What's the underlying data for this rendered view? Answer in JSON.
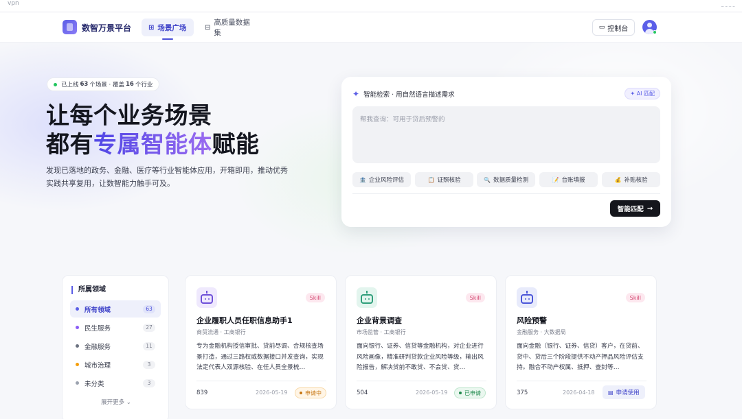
{
  "browser": {
    "url_text": "vpn"
  },
  "nav": {
    "brand": "数智万景平台",
    "tabs": [
      {
        "label": "场景广场",
        "icon": "grid-icon",
        "active": true
      },
      {
        "label": "高质量数据集",
        "icon": "database-icon",
        "active": false
      }
    ],
    "console_label": "控制台"
  },
  "hero": {
    "stat_prefix": "已上线",
    "stat_scenes": "63",
    "stat_mid": "个场景 · 覆盖",
    "stat_industries": "16",
    "stat_suffix": "个行业",
    "title_line1": "让每个业务场景",
    "title_line2_pre": "都有",
    "title_line2_accent": "专属智能体",
    "title_line2_post": "赋能",
    "description": "发现已落地的政务、金融、医疗等行业智能体应用，开箱即用，推动优秀实践共享复用，让数智能力触手可及。"
  },
  "search": {
    "heading": "智能检索 · 用自然语言描述需求",
    "ai_badge": "✦ AI 匹配",
    "placeholder": "帮我查询：可用于贷后预警的",
    "chips": [
      {
        "label": "企业风险评估",
        "icon": "🏦"
      },
      {
        "label": "证照核验",
        "icon": "📋"
      },
      {
        "label": "数据质量检测",
        "icon": "🔍"
      },
      {
        "label": "台账填报",
        "icon": "📝"
      },
      {
        "label": "补贴核验",
        "icon": "💰"
      }
    ],
    "submit_label": "智能匹配",
    "submit_arrow": "→"
  },
  "sidebar": {
    "title": "所属领域",
    "items": [
      {
        "label": "所有领域",
        "count": "63",
        "color": "#5b5ee6",
        "active": true
      },
      {
        "label": "民生服务",
        "count": "27",
        "color": "#8b5cf6",
        "active": false
      },
      {
        "label": "金融服务",
        "count": "11",
        "color": "#6b7280",
        "active": false
      },
      {
        "label": "城市治理",
        "count": "3",
        "color": "#f59e0b",
        "active": false
      },
      {
        "label": "未分类",
        "count": "3",
        "color": "#9ca3af",
        "active": false
      }
    ],
    "expand_label": "展开更多 ⌄"
  },
  "cards": [
    {
      "title": "企业履职人员任职信息助手1",
      "meta": "商贸流通 · 工商银行",
      "tag": "Skill",
      "description": "专为金融机构授信审批、贷前尽调、合规核查场景打造，通过三路权威数据接口并发查询，实现法定代表人双源核验、在任人员全景梳…",
      "views": "839",
      "date": "2026-05-19",
      "status": "申请中",
      "status_type": "pending",
      "icon_color": "#6d4fd8",
      "icon_bg": "#efe9fd"
    },
    {
      "title": "企业背景调查",
      "meta": "市场监管 · 工商银行",
      "tag": "Skill",
      "description": "面向银行、证券、信贷等金融机构，对企业进行风险画像，精准研判贷款企业风险等级，输出风险报告，解决贷前不敢贷、不会贷、贷…",
      "views": "504",
      "date": "2026-05-19",
      "status": "已申请",
      "status_type": "done",
      "icon_color": "#2f9e7a",
      "icon_bg": "#e3f5ee"
    },
    {
      "title": "风险预警",
      "meta": "金融服务 · 大数据局",
      "tag": "Skill",
      "description": "面向金融（银行、证券、信贷）客户，在贷前、贷中、贷后三个阶段提供不动产押品风险评估支持。融合不动产权属、抵押、查封等…",
      "views": "375",
      "date": "2026-04-18",
      "status": "申请使用",
      "status_type": "apply",
      "icon_color": "#4a55d8",
      "icon_bg": "#e8ebfb"
    }
  ]
}
